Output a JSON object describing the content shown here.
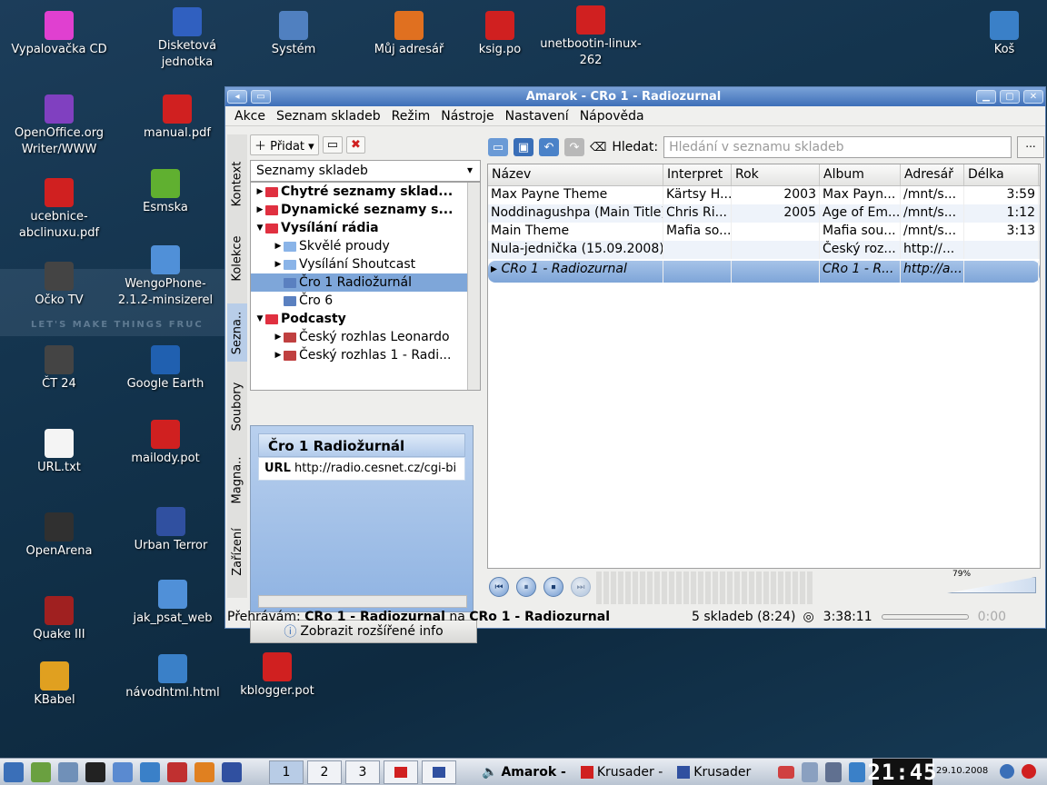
{
  "desktop": {
    "band_text": "LET'S MAKE THINGS FRUC",
    "icons": [
      {
        "label": "Vypalovačka CD",
        "icon": "cd-burner-icon",
        "color": "#e040d0"
      },
      {
        "label": "Disketová jednotka",
        "icon": "floppy-icon",
        "color": "#3060c0"
      },
      {
        "label": "Systém",
        "icon": "computer-icon",
        "color": "#5080c0"
      },
      {
        "label": "Můj adresář",
        "icon": "home-icon",
        "color": "#e07020"
      },
      {
        "label": "ksig.po",
        "icon": "po-file-icon",
        "color": "#d02020"
      },
      {
        "label": "unetbootin-linux-262",
        "icon": "unetbootin-icon",
        "color": "#d02020"
      },
      {
        "label": "Koš",
        "icon": "trash-icon",
        "color": "#3a80c8"
      },
      {
        "label": "OpenOffice.org Writer/WWW",
        "icon": "openoffice-icon",
        "color": "#8040c0"
      },
      {
        "label": "manual.pdf",
        "icon": "pdf-icon",
        "color": "#d02020"
      },
      {
        "label": "ucebnice-abclinuxu.pdf",
        "icon": "pdf-icon",
        "color": "#d02020"
      },
      {
        "label": "Esmska",
        "icon": "phone-icon",
        "color": "#60b030"
      },
      {
        "label": "Očko TV",
        "icon": "tv-icon",
        "color": "#444444"
      },
      {
        "label": "WengoPhone-2.1.2-minsizerel",
        "icon": "folder-icon",
        "color": "#5090d8"
      },
      {
        "label": "ČT 24",
        "icon": "tv-icon",
        "color": "#444444"
      },
      {
        "label": "Google Earth",
        "icon": "globe-icon",
        "color": "#2060b0"
      },
      {
        "label": "URL.txt",
        "icon": "text-file-icon",
        "color": "#f4f4f4"
      },
      {
        "label": "mailody.pot",
        "icon": "po-file-icon",
        "color": "#d02020"
      },
      {
        "label": "OpenArena",
        "icon": "openarena-icon",
        "color": "#303030"
      },
      {
        "label": "Urban Terror",
        "icon": "urban-terror-icon",
        "color": "#3050a0"
      },
      {
        "label": "Quake III",
        "icon": "quake-icon",
        "color": "#a02020"
      },
      {
        "label": "jak_psat_web",
        "icon": "folder-icon",
        "color": "#5090d8"
      },
      {
        "label": "KBabel",
        "icon": "kbabel-icon",
        "color": "#e0a020"
      },
      {
        "label": "návodhtml.html",
        "icon": "html-file-icon",
        "color": "#3a80c8"
      },
      {
        "label": "kblogger.pot",
        "icon": "po-file-icon",
        "color": "#d02020"
      }
    ]
  },
  "window": {
    "title": "Amarok - CRo 1 - Radiozurnal",
    "menu": [
      "Akce",
      "Seznam skladeb",
      "Režim",
      "Nástroje",
      "Nastavení",
      "Nápověda"
    ],
    "side_tabs": [
      "Kontext",
      "Kolekce",
      "Sezna..",
      "Soubory",
      "Magna..",
      "Zařízení"
    ]
  },
  "left": {
    "add_label": "Přidat",
    "combo_value": "Seznamy skladeb",
    "tree": [
      {
        "label": "Chytré seznamy sklad...",
        "bold": true,
        "expanded": false,
        "depth": 0,
        "folder": "#e03040"
      },
      {
        "label": "Dynamické seznamy s...",
        "bold": true,
        "expanded": false,
        "depth": 0,
        "folder": "#e03040"
      },
      {
        "label": "Vysílání rádia",
        "bold": true,
        "expanded": true,
        "depth": 0,
        "folder": "#e03040"
      },
      {
        "label": "Skvělé proudy",
        "bold": false,
        "expanded": false,
        "depth": 1,
        "folder": "#8ab4e8"
      },
      {
        "label": "Vysílání Shoutcast",
        "bold": false,
        "expanded": false,
        "depth": 1,
        "folder": "#8ab4e8"
      },
      {
        "label": "Čro 1 Radiožurnál",
        "bold": false,
        "expanded": null,
        "depth": 1,
        "folder": "#5a80c0",
        "selected": true
      },
      {
        "label": "Čro 6",
        "bold": false,
        "expanded": null,
        "depth": 1,
        "folder": "#5a80c0"
      },
      {
        "label": "Podcasty",
        "bold": true,
        "expanded": true,
        "depth": 0,
        "folder": "#e03040"
      },
      {
        "label": "Český rozhlas Leonardo",
        "bold": false,
        "expanded": false,
        "depth": 1,
        "folder": "#c04040"
      },
      {
        "label": "Český rozhlas 1 - Radi...",
        "bold": false,
        "expanded": false,
        "depth": 1,
        "folder": "#c04040"
      }
    ],
    "info_title": "Čro 1 Radiožurnál",
    "info_url_label": "URL",
    "info_url": "http://radio.cesnet.cz/cgi-bi",
    "more_info": "Zobrazit rozšířené info"
  },
  "right": {
    "search_label": "Hledat:",
    "search_placeholder": "Hledání v seznamu skladeb",
    "more_button": "...",
    "columns": [
      "Název",
      "Interpret",
      "Rok",
      "Album",
      "Adresář",
      "Délka"
    ],
    "rows": [
      [
        "Max Payne Theme",
        "Kärtsy H...",
        "2003",
        "Max Payn...",
        "/mnt/s...",
        "3:59"
      ],
      [
        "Noddinagushpa (Main Title)",
        "Chris Ri...",
        "2005",
        "Age of Em...",
        "/mnt/s...",
        "1:12"
      ],
      [
        "Main Theme",
        "Mafia so...",
        "",
        "Mafia sou...",
        "/mnt/s...",
        "3:13"
      ],
      [
        "Nula-jednička (15.09.2008)",
        "",
        "",
        "Český roz...",
        "http://...",
        ""
      ]
    ],
    "playing_row": [
      "CRo 1 - Radiozurnal",
      "",
      "",
      "CRo 1 - R...",
      "http://a...",
      ""
    ],
    "volume": "79%"
  },
  "status": {
    "playing_prefix": "Přehrávám:",
    "track": "CRo 1 - Radiozurnal",
    "on": "na",
    "station": "CRo 1 - Radiozurnal",
    "count": "5 skladeb (8:24)",
    "elapsed": "3:38:11",
    "remaining": "0:00"
  },
  "taskbar": {
    "pages": [
      "1",
      "2",
      "3"
    ],
    "tasks": [
      "Amarok -",
      "Krusader -",
      "Krusader"
    ],
    "clock": "21:45",
    "date": "29.10.2008"
  }
}
